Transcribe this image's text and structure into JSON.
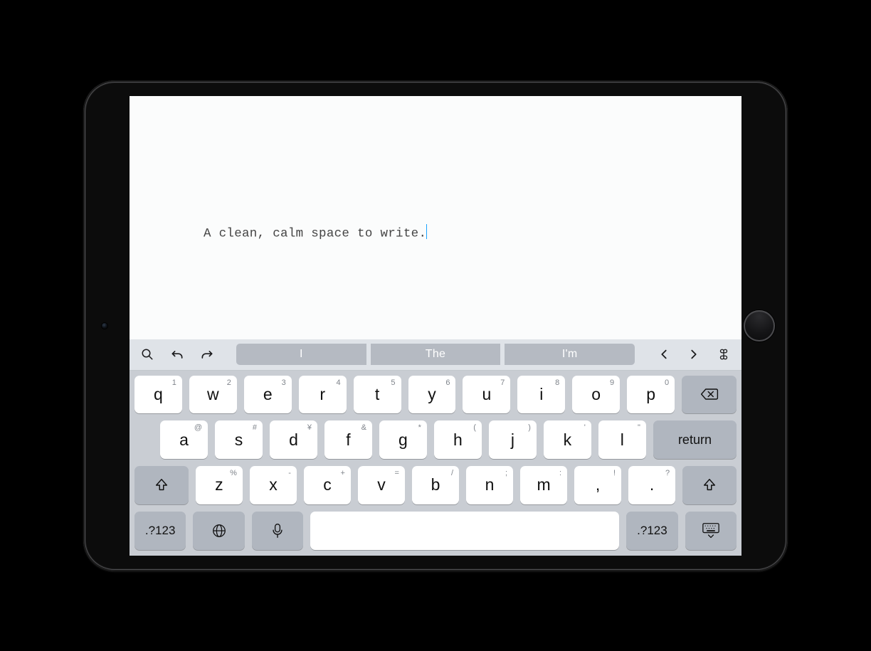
{
  "editor": {
    "text": "A clean, calm space to write."
  },
  "accessory": {
    "icons": {
      "search": "search-icon",
      "undo": "undo-icon",
      "redo": "redo-icon",
      "prev": "chevron-left-icon",
      "next": "chevron-right-icon",
      "command": "command-icon"
    },
    "predictions": [
      "I",
      "The",
      "I'm"
    ]
  },
  "keyboard": {
    "row1": [
      {
        "main": "q",
        "sub": "1"
      },
      {
        "main": "w",
        "sub": "2"
      },
      {
        "main": "e",
        "sub": "3"
      },
      {
        "main": "r",
        "sub": "4"
      },
      {
        "main": "t",
        "sub": "5"
      },
      {
        "main": "y",
        "sub": "6"
      },
      {
        "main": "u",
        "sub": "7"
      },
      {
        "main": "i",
        "sub": "8"
      },
      {
        "main": "o",
        "sub": "9"
      },
      {
        "main": "p",
        "sub": "0"
      }
    ],
    "row2": [
      {
        "main": "a",
        "sub": "@"
      },
      {
        "main": "s",
        "sub": "#"
      },
      {
        "main": "d",
        "sub": "¥"
      },
      {
        "main": "f",
        "sub": "&"
      },
      {
        "main": "g",
        "sub": "*"
      },
      {
        "main": "h",
        "sub": "("
      },
      {
        "main": "j",
        "sub": ")"
      },
      {
        "main": "k",
        "sub": "'"
      },
      {
        "main": "l",
        "sub": "\""
      }
    ],
    "row3": [
      {
        "main": "z",
        "sub": "%"
      },
      {
        "main": "x",
        "sub": "-"
      },
      {
        "main": "c",
        "sub": "+"
      },
      {
        "main": "v",
        "sub": "="
      },
      {
        "main": "b",
        "sub": "/"
      },
      {
        "main": "n",
        "sub": ";"
      },
      {
        "main": "m",
        "sub": ":"
      },
      {
        "main": ",",
        "sub": "!"
      },
      {
        "main": ".",
        "sub": "?"
      }
    ],
    "labels": {
      "return": "return",
      "numbers": ".?123"
    }
  }
}
